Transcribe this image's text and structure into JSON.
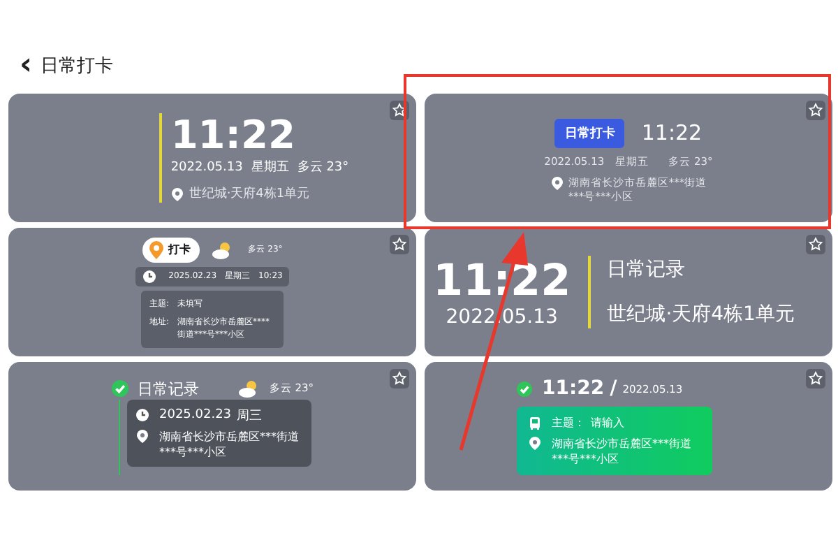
{
  "header": {
    "back": "‹",
    "title": "日常打卡"
  },
  "cards": [
    {
      "kind": "clock_bar",
      "time": "11:22",
      "date": "2022.05.13",
      "weekday": "星期五",
      "weather": "多云 23°",
      "location": "世纪城·天府4栋1单元"
    },
    {
      "kind": "badge_time",
      "badge": "日常打卡",
      "time": "11:22",
      "date": "2022.05.13",
      "weekday": "星期五",
      "weather": "多云 23°",
      "address": [
        "湖南省长沙市岳麓区***街道",
        "***号***小区"
      ]
    },
    {
      "kind": "punch_card",
      "logo": "打卡",
      "weather": "多云 23°",
      "date": "2025.02.23",
      "weekday": "星期三",
      "time": "10:23",
      "topic_label": "主题:",
      "topic": "未填写",
      "address_label": "地址:",
      "address": [
        "湖南省长沙市岳麓区****",
        "街道***号***小区"
      ]
    },
    {
      "kind": "big_time",
      "time": "11:22",
      "date": "2022.05.13",
      "title": "日常记录",
      "location": "世纪城·天府4栋1单元"
    },
    {
      "kind": "check_record",
      "title": "日常记录",
      "weather": "多云 23°",
      "date": "2025.02.23",
      "weekday": "周三",
      "address": [
        "湖南省长沙市岳麓区***街道",
        "***号***小区"
      ]
    },
    {
      "kind": "green_card",
      "time": "11:22",
      "separator": "/",
      "date": "2022.05.13",
      "topic_label": "主题：",
      "topic_placeholder": "请输入",
      "address": [
        "湖南省长沙市岳麓区***街道",
        "***号***小区"
      ]
    }
  ],
  "annotation": {
    "highlight_box": true,
    "arrow": true
  }
}
